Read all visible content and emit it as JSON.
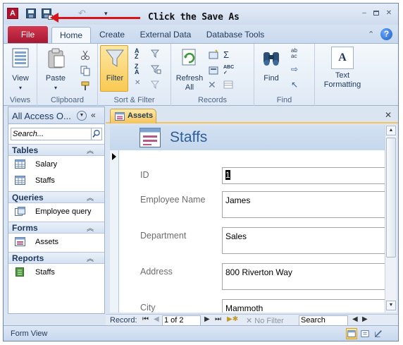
{
  "annotation": {
    "text": "Click the Save As"
  },
  "qat": {
    "app_letter": "A",
    "save_icon": "save-disk-icon",
    "save_as_icon": "save-as-icon",
    "undo_glyph": "↶",
    "customize_glyph": "▾"
  },
  "window_controls": {
    "minimize": "‒",
    "close": "✕"
  },
  "ribbon_tabs": {
    "file": "File",
    "home": "Home",
    "create": "Create",
    "external_data": "External Data",
    "database_tools": "Database Tools"
  },
  "help_glyph": "?",
  "collapse_glyph": "⌃",
  "ribbon": {
    "groups": {
      "views": "Views",
      "clipboard": "Clipboard",
      "sort_filter": "Sort & Filter",
      "records": "Records",
      "find": "Find"
    },
    "buttons": {
      "view": "View",
      "paste": "Paste",
      "filter": "Filter",
      "refresh_line1": "Refresh",
      "refresh_line2": "All",
      "find": "Find",
      "text_formatting_line1": "Text",
      "text_formatting_line2": "Formatting"
    }
  },
  "nav": {
    "title": "All Access O...",
    "search_placeholder": "Search...",
    "categories": [
      {
        "label": "Tables",
        "items": [
          "Salary",
          "Staffs"
        ]
      },
      {
        "label": "Queries",
        "items": [
          "Employee query"
        ]
      },
      {
        "label": "Forms",
        "items": [
          "Assets"
        ]
      },
      {
        "label": "Reports",
        "items": [
          "Staffs"
        ]
      }
    ]
  },
  "document": {
    "tab_label": "Assets",
    "form_title": "Staffs",
    "fields": [
      {
        "label": "ID",
        "value": "1"
      },
      {
        "label": "Employee Name",
        "value": "James"
      },
      {
        "label": "Department",
        "value": "Sales"
      },
      {
        "label": "Address",
        "value": "800 Riverton Way"
      },
      {
        "label": "City",
        "value": "Mammoth"
      }
    ]
  },
  "record_nav": {
    "label": "Record:",
    "position": "1 of 2",
    "filter": "No Filter",
    "search": "Search"
  },
  "status": {
    "text": "Form View"
  },
  "colors": {
    "file_tab": "#b71f37",
    "annotation_arrow": "#d9141b",
    "active_tab": "#f7c25b"
  }
}
